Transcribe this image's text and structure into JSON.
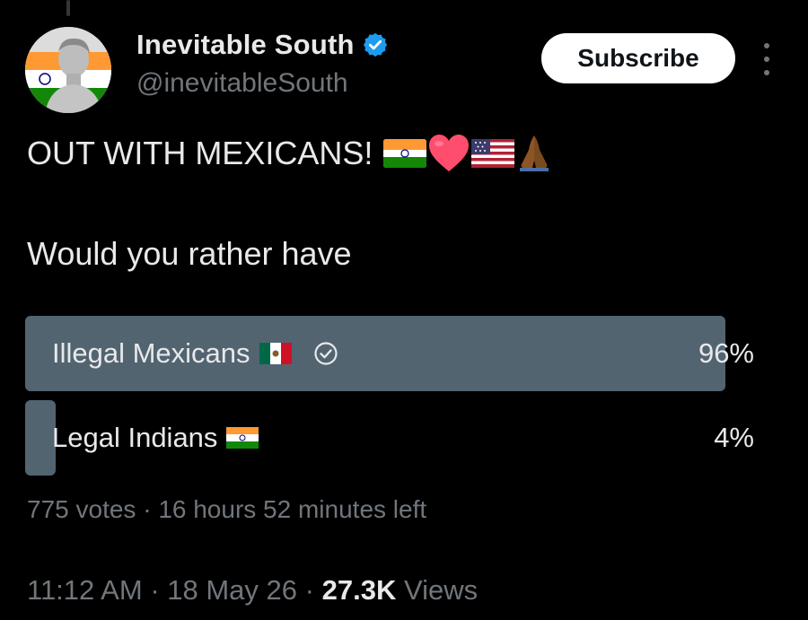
{
  "author": {
    "display_name": "Inevitable South",
    "handle": "@inevitableSouth",
    "verified": true,
    "avatar_icon": "statue-portrait-with-india-flag"
  },
  "actions": {
    "subscribe_label": "Subscribe",
    "more_icon": "more-vertical-icon"
  },
  "tweet": {
    "line1": "OUT WITH MEXICANS!",
    "line1_emojis": [
      "india-flag",
      "red-heart",
      "us-flag",
      "folded-hands"
    ],
    "line2": "Would you rather have"
  },
  "poll": {
    "options": [
      {
        "label": "Illegal Mexicans",
        "flag": "mexico-flag",
        "voted": true,
        "percent_label": "96%",
        "percent": 96
      },
      {
        "label": "Legal Indians",
        "flag": "india-flag",
        "voted": false,
        "percent_label": "4%",
        "percent": 4
      }
    ],
    "votes": "775 votes",
    "separator": "·",
    "time_left": "16 hours 52 minutes left"
  },
  "meta": {
    "time": "11:12 AM",
    "date": "18 May 26",
    "views_count": "27.3K",
    "views_label": "Views",
    "separator": "·"
  },
  "colors": {
    "background": "#000000",
    "text_primary": "#e7e9ea",
    "text_secondary": "#71767b",
    "poll_bar": "#536471",
    "verified_blue": "#1d9bf0"
  }
}
